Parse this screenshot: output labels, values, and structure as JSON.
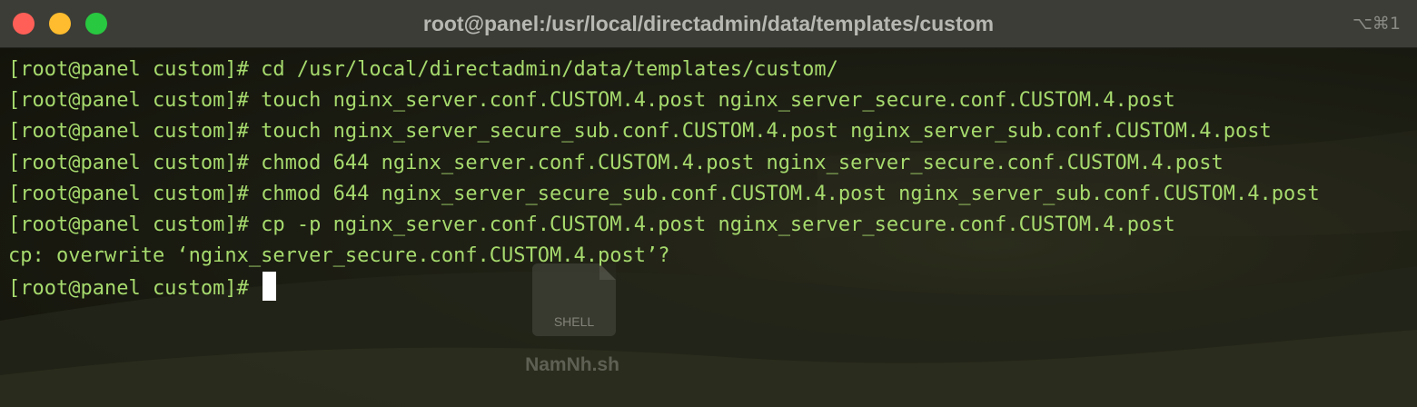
{
  "window": {
    "title": "root@panel:/usr/local/directadmin/data/templates/custom",
    "shortcut": "⌥⌘1",
    "traffic_lights": {
      "close": "#ff5f57",
      "minimize": "#febc2e",
      "zoom": "#28c840"
    }
  },
  "terminal": {
    "text_color": "#a6da6d",
    "lines": [
      "[root@panel custom]# cd /usr/local/directadmin/data/templates/custom/",
      "[root@panel custom]# touch nginx_server.conf.CUSTOM.4.post nginx_server_secure.conf.CUSTOM.4.post",
      "[root@panel custom]# touch nginx_server_secure_sub.conf.CUSTOM.4.post nginx_server_sub.conf.CUSTOM.4.post",
      "[root@panel custom]# chmod 644 nginx_server.conf.CUSTOM.4.post nginx_server_secure.conf.CUSTOM.4.post",
      "[root@panel custom]# chmod 644 nginx_server_secure_sub.conf.CUSTOM.4.post nginx_server_sub.conf.CUSTOM.4.post",
      "[root@panel custom]# cp -p nginx_server.conf.CUSTOM.4.post nginx_server_secure.conf.CUSTOM.4.post",
      "cp: overwrite ‘nginx_server_secure.conf.CUSTOM.4.post’?"
    ],
    "prompt": "[root@panel custom]# "
  },
  "watermark": {
    "file_label": "SHELL",
    "brand": "NamNh.sh"
  }
}
